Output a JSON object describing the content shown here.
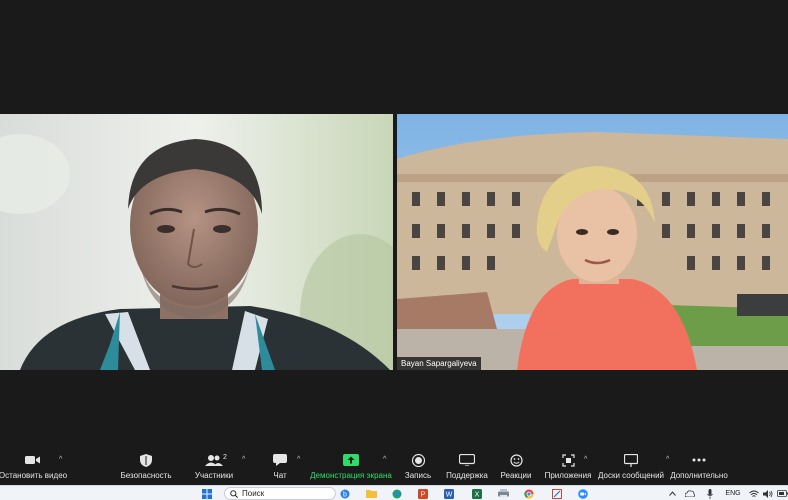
{
  "meeting": {
    "participant_right_name": "Bayan Sapargaliyeva"
  },
  "toolbar": {
    "stop_video": "Остановить видео",
    "security": "Безопасность",
    "participants": "Участники",
    "participant_count": "2",
    "chat": "Чат",
    "share_screen": "Демонстрация экрана",
    "record": "Запись",
    "support": "Поддержка",
    "reactions": "Реакции",
    "apps": "Приложения",
    "whiteboards": "Доски сообщений",
    "more": "Дополнительно",
    "share_color": "#2fdc6a"
  },
  "taskbar": {
    "search_placeholder": "Поиск",
    "language": "ENG"
  }
}
